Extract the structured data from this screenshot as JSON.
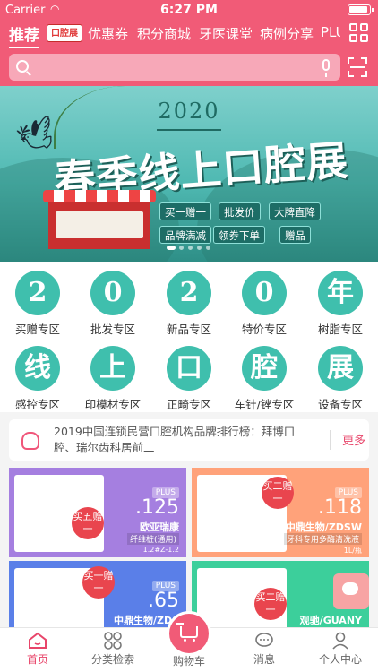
{
  "status": {
    "carrier": "Carrier",
    "time": "6:27 PM"
  },
  "tabs": [
    {
      "label": "推荐"
    },
    {
      "label": "口腔展"
    },
    {
      "label": "优惠券"
    },
    {
      "label": "积分商城"
    },
    {
      "label": "牙医课堂"
    },
    {
      "label": "病例分享"
    },
    {
      "label": "PLU"
    }
  ],
  "banner": {
    "year": "2020",
    "title": "春季线上口腔展",
    "pills": [
      "买一赠一",
      "批发价",
      "大牌直降",
      "品牌满减",
      "领券下单",
      "赠品"
    ]
  },
  "categories": [
    {
      "char": "2",
      "label": "买赠专区"
    },
    {
      "char": "0",
      "label": "批发专区"
    },
    {
      "char": "2",
      "label": "新品专区"
    },
    {
      "char": "0",
      "label": "特价专区"
    },
    {
      "char": "年",
      "label": "树脂专区"
    },
    {
      "char": "线",
      "label": "感控专区"
    },
    {
      "char": "上",
      "label": "印模材专区"
    },
    {
      "char": "口",
      "label": "正畸专区"
    },
    {
      "char": "腔",
      "label": "车针/锉专区"
    },
    {
      "char": "展",
      "label": "设备专区"
    }
  ],
  "notice": {
    "text": "2019中国连锁民营口腔机构品牌排行榜：拜博口腔、瑞尔齿科居前二",
    "more": "更多"
  },
  "products": [
    {
      "badge": "买五赠一",
      "plus": "PLUS",
      "price": ".125",
      "brand": "欧亚瑞康",
      "desc": "纤维桩(通用)",
      "spec": "1.2#Z-1.2",
      "color": "#a57fe0"
    },
    {
      "badge": "买二赠一",
      "plus": "PLUS",
      "price": ".118",
      "brand": "中鼎生物/ZDSW",
      "desc": "牙科专用多酶清洗液",
      "spec": "1L/瓶",
      "color": "#ffa27a"
    },
    {
      "badge": "买一赠一",
      "plus": "PLUS",
      "price": ".65",
      "brand": "中鼎生物/ZDS",
      "desc": "",
      "spec": "",
      "color": "#5a7fe8"
    },
    {
      "badge": "买二赠一",
      "plus": "",
      "price": "",
      "brand": "观驰/GUANY",
      "desc": "",
      "spec": "",
      "color": "#3ccf9b"
    }
  ],
  "nav": [
    {
      "label": "首页"
    },
    {
      "label": "分类检索"
    },
    {
      "label": "购物车"
    },
    {
      "label": "消息"
    },
    {
      "label": "个人中心"
    }
  ]
}
